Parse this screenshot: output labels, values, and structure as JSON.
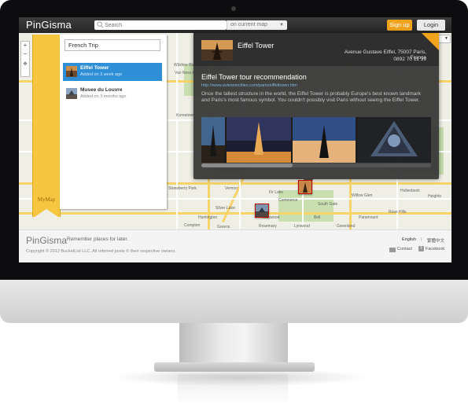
{
  "app": {
    "logo_text": "PinGisma",
    "search": {
      "placeholder": "Search"
    },
    "scope": {
      "selected": "on current map"
    },
    "signup_label": "Sign up",
    "login_label": "Login"
  },
  "map": {
    "type_selected": "地圖",
    "zoom": {
      "in": "+",
      "out": "−"
    },
    "labels": [
      "Wilshire Blvd",
      "Van Ness Ave",
      "Koreatown",
      "Strawberry Park",
      "Hollenbeck",
      "Heights",
      "Willow Glen",
      "Silver Lake",
      "Rose Hills",
      "Commerce",
      "Vernon",
      "Bell",
      "Fir Lake",
      "Maywood",
      "Greenland",
      "Paramount",
      "Compton",
      "Rosemary",
      "Lynwood",
      "South Gate",
      "Greens",
      "Huntington"
    ],
    "ribbon_label": "MyMap"
  },
  "trip": {
    "name": "French Trip",
    "places": [
      {
        "name": "Eiffel Tower",
        "meta": "Added on 3 week ago"
      },
      {
        "name": "Musee du Louvre",
        "meta": "Added on 3 months ago"
      }
    ]
  },
  "popup": {
    "title": "Eiffel Tower",
    "address": "Avenue Gustave Eiffel, 75007 Paris, France",
    "phone": "0892 70 12 39",
    "recommendation_title": "Eiffel Tower tour recommendation",
    "link": "http://www.aviewoncities.com/paris/eiffeltower.htm",
    "description": "Once the tallest structure in the world, the Eiffel Tower is probably Europe's best known landmark and Paris's most famous symbol. You couldn't possibly visit Paris without seeing the Eiffel Tower."
  },
  "footer": {
    "logo_text": "PinGisma",
    "tagline": "Remember places for later.",
    "copyright": "Copyright © 2012 BucketList LLC. All referred posts © their respective owners.",
    "lang_en": "English",
    "lang_sep": "|",
    "lang_zh": "繁體中文",
    "contact": "Contact",
    "facebook": "Facebook"
  },
  "colors": {
    "accent_orange": "#f1a31c",
    "selected_blue": "#2f8fd6",
    "ribbon_yellow": "#f7c640"
  }
}
